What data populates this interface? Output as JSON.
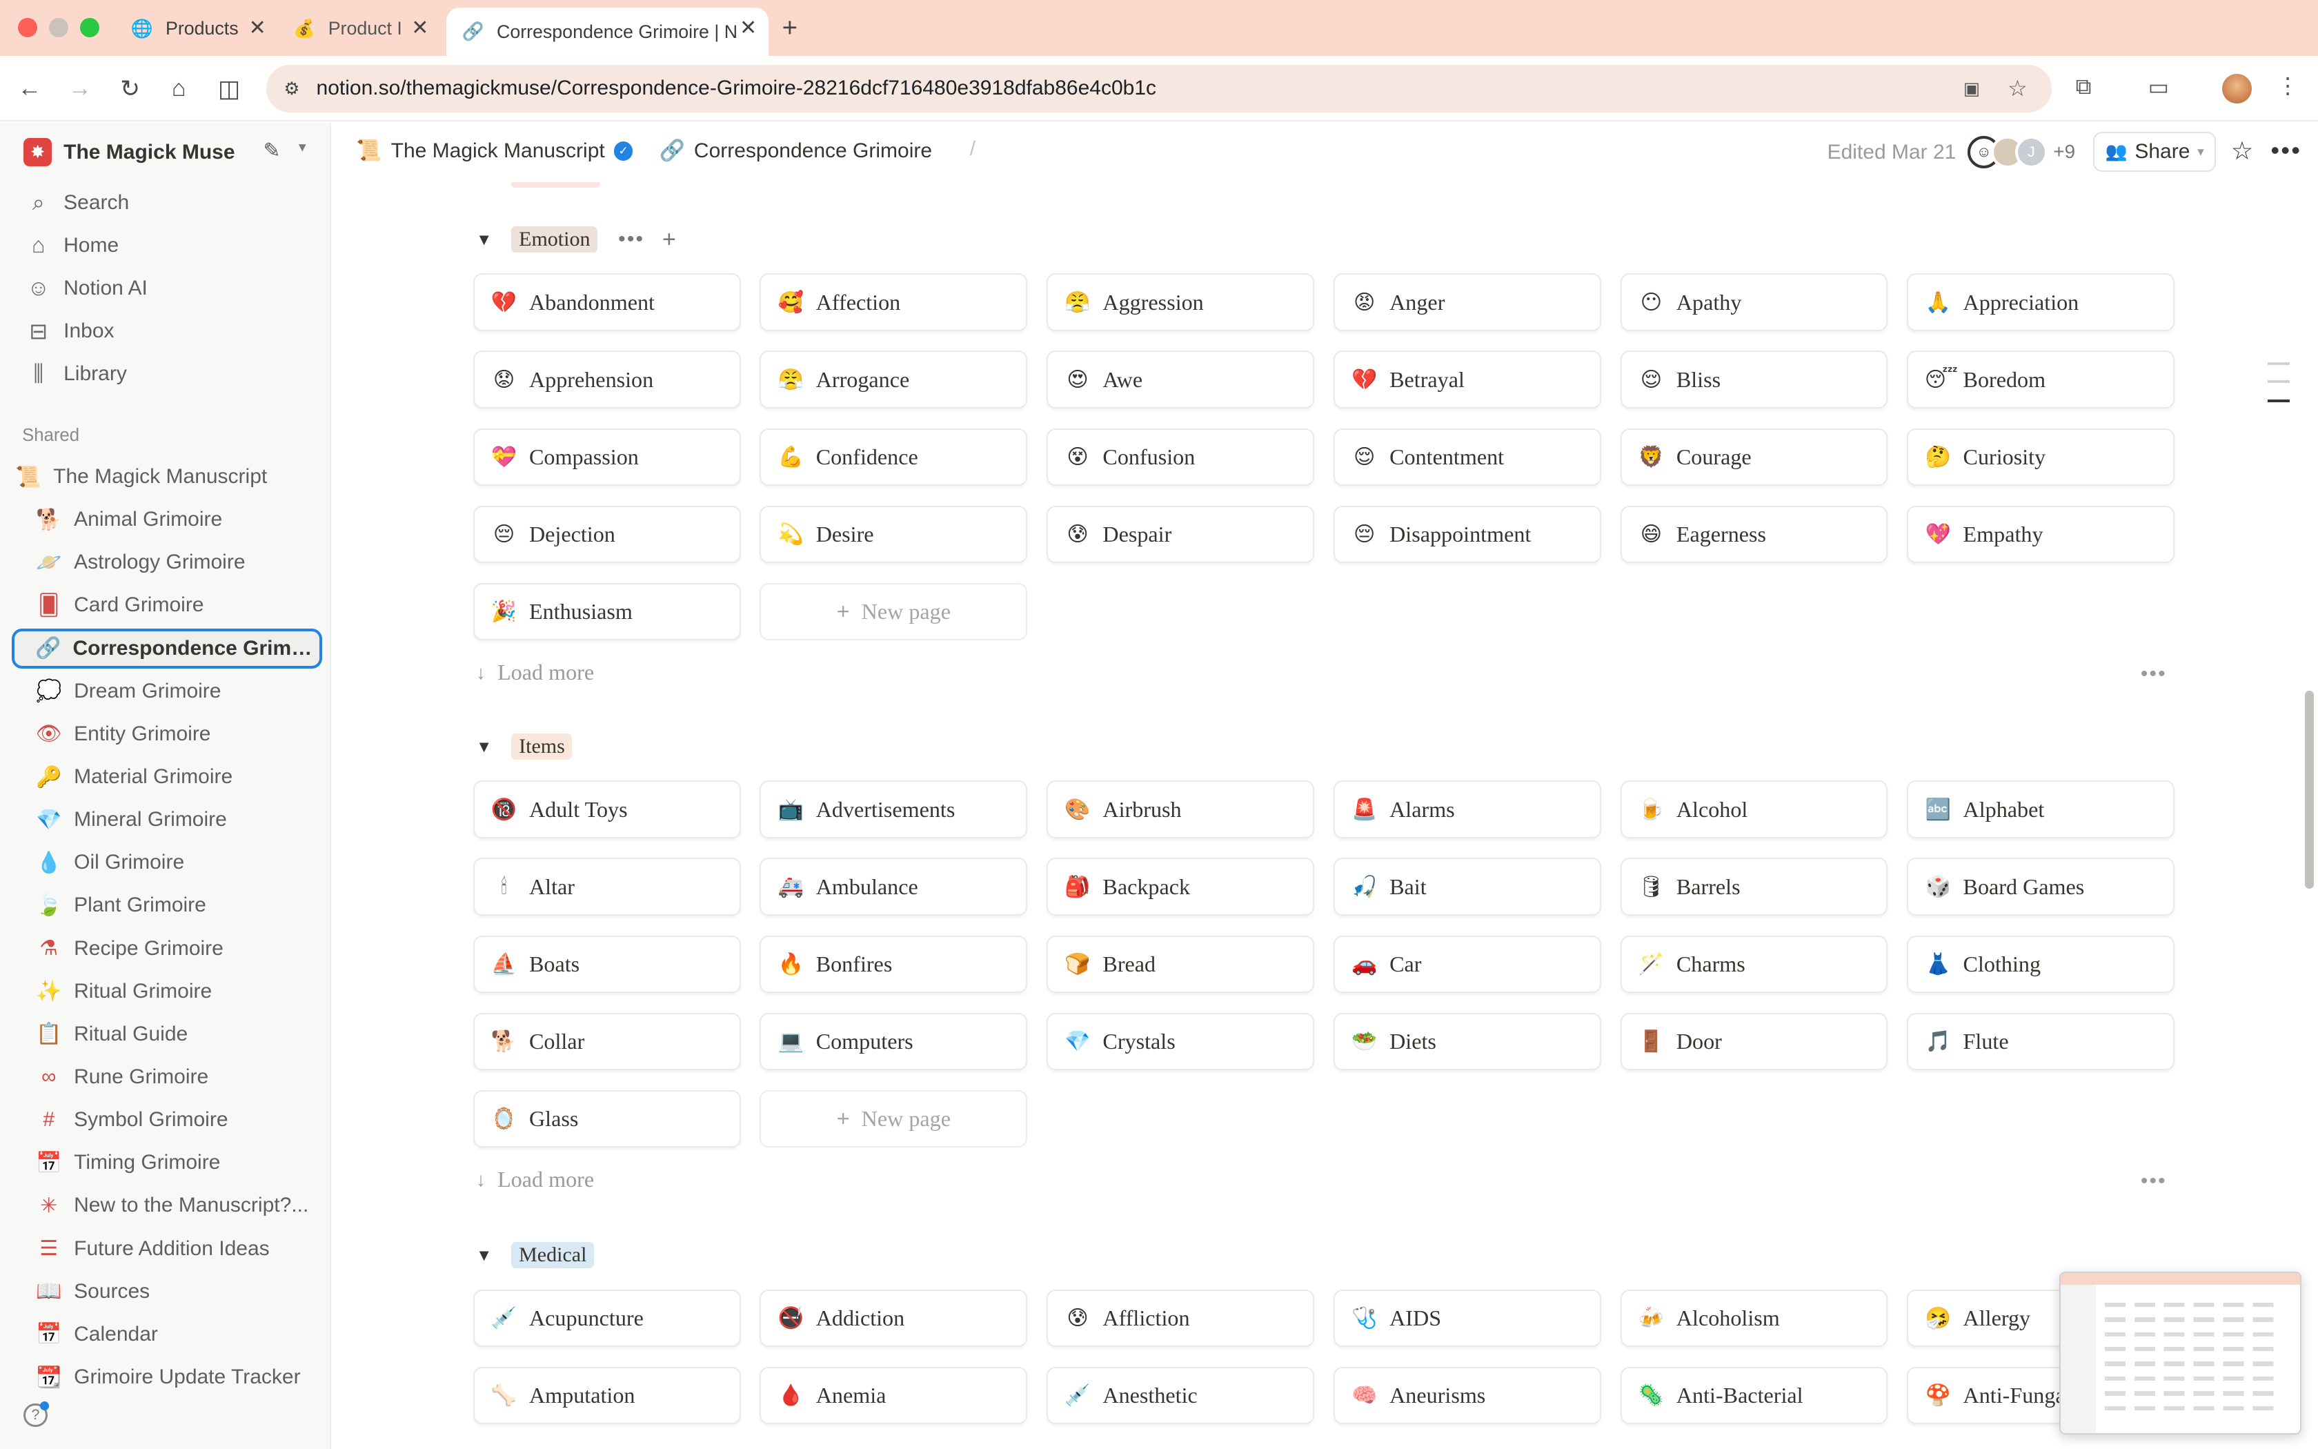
{
  "browser": {
    "tabs": [
      {
        "title": "Products",
        "icon": "globe-icon"
      },
      {
        "title": "Product I",
        "icon": "money-bag-icon"
      },
      {
        "title": "Correspondence Grimoire | N",
        "icon": "link-icon"
      }
    ],
    "url": "notion.so/themagickmuse/Correspondence-Grimoire-28216dcf716480e3918dfab86e4c0b1c"
  },
  "sidebar": {
    "workspace": "The Magick Muse",
    "nav": [
      {
        "label": "Search",
        "icon": "search-icon"
      },
      {
        "label": "Home",
        "icon": "home-icon"
      },
      {
        "label": "Notion AI",
        "icon": "ai-face-icon"
      },
      {
        "label": "Inbox",
        "icon": "inbox-icon"
      },
      {
        "label": "Library",
        "icon": "library-icon"
      }
    ],
    "shared_label": "Shared",
    "pages": [
      {
        "label": "The Magick Manuscript",
        "icon": "📜"
      },
      {
        "label": "Animal Grimoire",
        "icon": "🐕"
      },
      {
        "label": "Astrology Grimoire",
        "icon": "🪐"
      },
      {
        "label": "Card Grimoire",
        "icon": "🂠"
      },
      {
        "label": "Correspondence Grimoi...",
        "icon": "🔗"
      },
      {
        "label": "Dream Grimoire",
        "icon": "💭"
      },
      {
        "label": "Entity Grimoire",
        "icon": "👁"
      },
      {
        "label": "Material Grimoire",
        "icon": "🔑"
      },
      {
        "label": "Mineral Grimoire",
        "icon": "💎"
      },
      {
        "label": "Oil Grimoire",
        "icon": "💧"
      },
      {
        "label": "Plant Grimoire",
        "icon": "🍃"
      },
      {
        "label": "Recipe Grimoire",
        "icon": "⚗"
      },
      {
        "label": "Ritual Grimoire",
        "icon": "✨"
      },
      {
        "label": "Ritual Guide",
        "icon": "📋"
      },
      {
        "label": "Rune Grimoire",
        "icon": "∞"
      },
      {
        "label": "Symbol Grimoire",
        "icon": "#"
      },
      {
        "label": "Timing Grimoire",
        "icon": "📅"
      },
      {
        "label": "New to the Manuscript?...",
        "icon": "✳"
      },
      {
        "label": "Future Addition Ideas",
        "icon": "☰"
      },
      {
        "label": "Sources",
        "icon": "📖"
      },
      {
        "label": "Calendar",
        "icon": "📅"
      },
      {
        "label": "Grimoire Update Tracker",
        "icon": "📆"
      }
    ]
  },
  "topbar": {
    "breadcrumb_parent": "The Magick Manuscript",
    "breadcrumb_current": "Correspondence Grimoire",
    "edited": "Edited Mar 21",
    "collaborators_extra": "+9",
    "share_label": "Share"
  },
  "groups": [
    {
      "tag": "Emotion",
      "tag_color": "#eee0da",
      "cards": [
        {
          "emoji": "💔",
          "title": "Abandonment"
        },
        {
          "emoji": "🥰",
          "title": "Affection"
        },
        {
          "emoji": "😤",
          "title": "Aggression"
        },
        {
          "emoji": "😡",
          "title": "Anger"
        },
        {
          "emoji": "😶",
          "title": "Apathy"
        },
        {
          "emoji": "🙏",
          "title": "Appreciation"
        },
        {
          "emoji": "😟",
          "title": "Apprehension"
        },
        {
          "emoji": "😤",
          "title": "Arrogance"
        },
        {
          "emoji": "😍",
          "title": "Awe"
        },
        {
          "emoji": "💔",
          "title": "Betrayal"
        },
        {
          "emoji": "😌",
          "title": "Bliss"
        },
        {
          "emoji": "😴",
          "title": "Boredom"
        },
        {
          "emoji": "💝",
          "title": "Compassion"
        },
        {
          "emoji": "💪",
          "title": "Confidence"
        },
        {
          "emoji": "😵",
          "title": "Confusion"
        },
        {
          "emoji": "😌",
          "title": "Contentment"
        },
        {
          "emoji": "🦁",
          "title": "Courage"
        },
        {
          "emoji": "🤔",
          "title": "Curiosity"
        },
        {
          "emoji": "😔",
          "title": "Dejection"
        },
        {
          "emoji": "💫",
          "title": "Desire"
        },
        {
          "emoji": "😰",
          "title": "Despair"
        },
        {
          "emoji": "😔",
          "title": "Disappointment"
        },
        {
          "emoji": "😄",
          "title": "Eagerness"
        },
        {
          "emoji": "💖",
          "title": "Empathy"
        },
        {
          "emoji": "🎉",
          "title": "Enthusiasm"
        }
      ]
    },
    {
      "tag": "Items",
      "tag_color": "#f8e7da",
      "cards": [
        {
          "emoji": "🔞",
          "title": "Adult Toys"
        },
        {
          "emoji": "📺",
          "title": "Advertisements"
        },
        {
          "emoji": "🎨",
          "title": "Airbrush"
        },
        {
          "emoji": "🚨",
          "title": "Alarms"
        },
        {
          "emoji": "🍺",
          "title": "Alcohol"
        },
        {
          "emoji": "🔤",
          "title": "Alphabet"
        },
        {
          "emoji": "🕯",
          "title": "Altar"
        },
        {
          "emoji": "🚑",
          "title": "Ambulance"
        },
        {
          "emoji": "🎒",
          "title": "Backpack"
        },
        {
          "emoji": "🎣",
          "title": "Bait"
        },
        {
          "emoji": "🛢",
          "title": "Barrels"
        },
        {
          "emoji": "🎲",
          "title": "Board Games"
        },
        {
          "emoji": "⛵",
          "title": "Boats"
        },
        {
          "emoji": "🔥",
          "title": "Bonfires"
        },
        {
          "emoji": "🍞",
          "title": "Bread"
        },
        {
          "emoji": "🚗",
          "title": "Car"
        },
        {
          "emoji": "🪄",
          "title": "Charms"
        },
        {
          "emoji": "👗",
          "title": "Clothing"
        },
        {
          "emoji": "🐕",
          "title": "Collar"
        },
        {
          "emoji": "💻",
          "title": "Computers"
        },
        {
          "emoji": "💎",
          "title": "Crystals"
        },
        {
          "emoji": "🥗",
          "title": "Diets"
        },
        {
          "emoji": "🚪",
          "title": "Door"
        },
        {
          "emoji": "🎵",
          "title": "Flute"
        },
        {
          "emoji": "🪞",
          "title": "Glass"
        }
      ]
    },
    {
      "tag": "Medical",
      "tag_color": "#d8e8f5",
      "cards": [
        {
          "emoji": "💉",
          "title": "Acupuncture"
        },
        {
          "emoji": "🚭",
          "title": "Addiction"
        },
        {
          "emoji": "😰",
          "title": "Affliction"
        },
        {
          "emoji": "🩺",
          "title": "AIDS"
        },
        {
          "emoji": "🍻",
          "title": "Alcoholism"
        },
        {
          "emoji": "🤧",
          "title": "Allergy"
        },
        {
          "emoji": "🦴",
          "title": "Amputation"
        },
        {
          "emoji": "🩸",
          "title": "Anemia"
        },
        {
          "emoji": "💉",
          "title": "Anesthetic"
        },
        {
          "emoji": "🧠",
          "title": "Aneurisms"
        },
        {
          "emoji": "🦠",
          "title": "Anti-Bacterial"
        },
        {
          "emoji": "🍄",
          "title": "Anti-Fungal"
        }
      ]
    }
  ],
  "new_page_label": "New page",
  "load_more_label": "Load more"
}
